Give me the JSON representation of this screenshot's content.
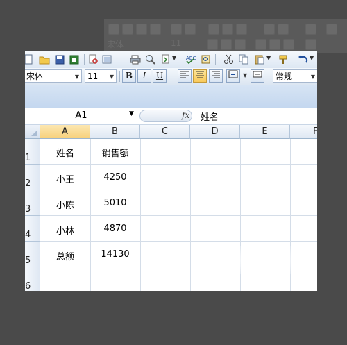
{
  "background_toolbar": {
    "font_name": "宋体",
    "font_size": "11"
  },
  "toolbar": {
    "font_name": "宋体",
    "font_size": "11",
    "bold_label": "B",
    "italic_label": "I",
    "underline_label": "U",
    "number_format": "常规"
  },
  "formula_bar": {
    "cell_reference": "A1",
    "fx_label": "fx",
    "content": "姓名"
  },
  "columns": [
    "A",
    "B",
    "C",
    "D",
    "E",
    "F"
  ],
  "active_column": "A",
  "rows": [
    "1",
    "2",
    "3",
    "4",
    "5",
    "6"
  ],
  "sheet": {
    "cells": [
      [
        "姓名",
        "销售额"
      ],
      [
        "小王",
        "4250"
      ],
      [
        "小陈",
        "5010"
      ],
      [
        "小林",
        "4870"
      ],
      [
        "总额",
        "14130"
      ]
    ]
  }
}
